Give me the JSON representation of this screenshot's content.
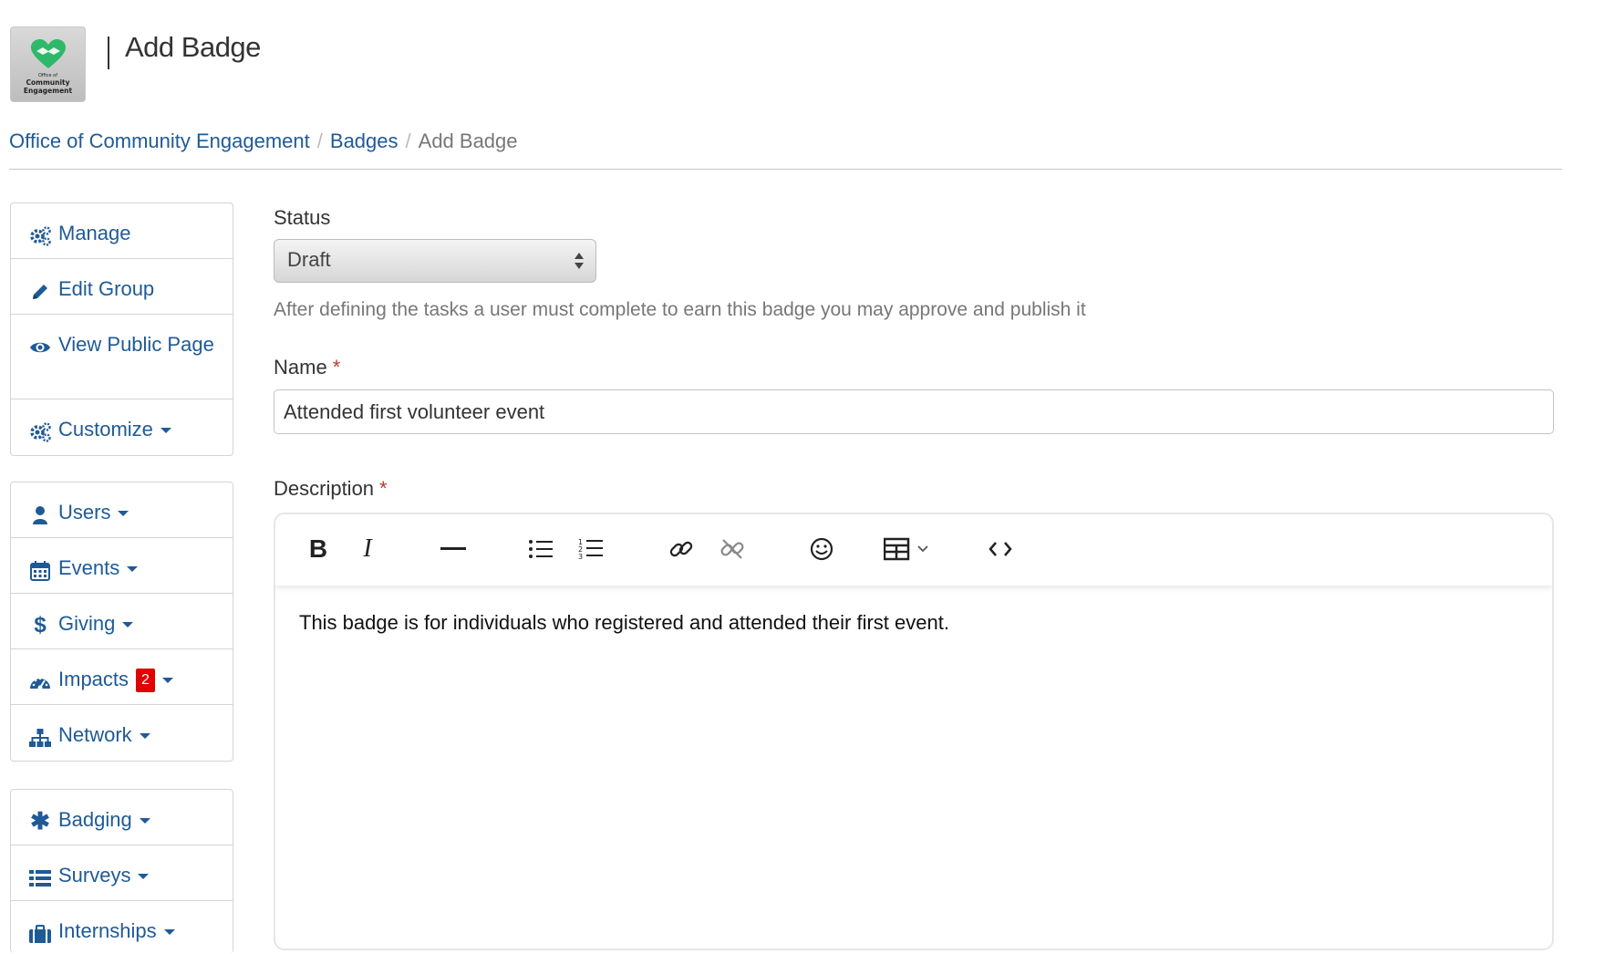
{
  "header": {
    "logo_line1": "Office of",
    "logo_line2": "Community",
    "logo_line3": "Engagement",
    "title": "Add Badge"
  },
  "breadcrumb": {
    "items": [
      "Office of Community Engagement",
      "Badges"
    ],
    "current": "Add Badge"
  },
  "sidebar": {
    "group1": [
      {
        "label": "Manage",
        "icon": "cogs-icon"
      },
      {
        "label": "Edit Group",
        "icon": "pencil-icon"
      },
      {
        "label": "View Public Page",
        "icon": "eye-icon"
      },
      {
        "label": "Customize",
        "icon": "cogs-icon",
        "dropdown": true
      }
    ],
    "group2": [
      {
        "label": "Users",
        "icon": "user-icon",
        "dropdown": true
      },
      {
        "label": "Events",
        "icon": "calendar-icon",
        "dropdown": true
      },
      {
        "label": "Giving",
        "icon": "dollar-icon",
        "dropdown": true
      },
      {
        "label": "Impacts",
        "icon": "gauge-icon",
        "dropdown": true,
        "badge": "2"
      },
      {
        "label": "Network",
        "icon": "sitemap-icon",
        "dropdown": true
      }
    ],
    "group3": [
      {
        "label": "Badging",
        "icon": "asterisk-icon",
        "dropdown": true
      },
      {
        "label": "Surveys",
        "icon": "list-icon",
        "dropdown": true
      },
      {
        "label": "Internships",
        "icon": "briefcase-icon",
        "dropdown": true
      }
    ]
  },
  "form": {
    "status_label": "Status",
    "status_value": "Draft",
    "status_help": "After defining the tasks a user must complete to earn this badge you may approve and publish it",
    "name_label": "Name",
    "name_value": "Attended first volunteer event",
    "description_label": "Description",
    "required_mark": "*",
    "description_value": "This badge is for individuals who registered and attended their first event."
  },
  "toolbar": [
    "bold-icon",
    "italic-icon",
    "horizontal-rule-icon",
    "bullet-list-icon",
    "numbered-list-icon",
    "link-icon",
    "unlink-icon",
    "emoji-icon",
    "table-icon",
    "code-icon"
  ],
  "colors": {
    "link": "#1f5a96",
    "badge": "#e00000",
    "heart": "#2fb86a"
  }
}
